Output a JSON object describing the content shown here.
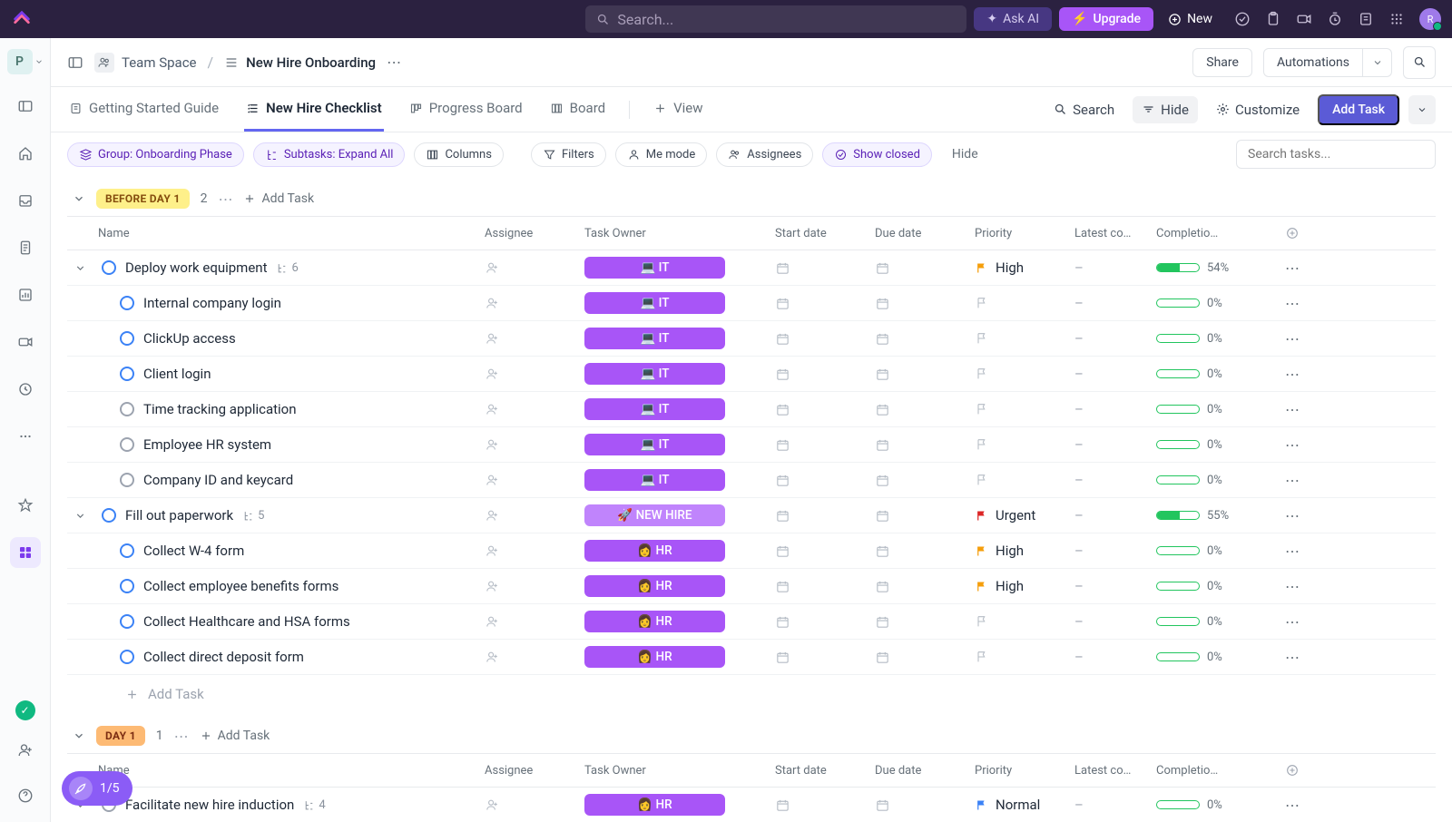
{
  "top": {
    "search_placeholder": "Search...",
    "ask_ai": "Ask AI",
    "upgrade": "Upgrade",
    "new_btn": "New",
    "avatar_letter": "R"
  },
  "workspace_letter": "P",
  "breadcrumb": {
    "team": "Team Space",
    "page": "New Hire Onboarding",
    "share": "Share",
    "automations": "Automations"
  },
  "views": {
    "tabs": [
      "Getting Started Guide",
      "New Hire Checklist",
      "Progress Board",
      "Board"
    ],
    "add_view": "View",
    "search": "Search",
    "hide": "Hide",
    "customize": "Customize",
    "add_task": "Add Task"
  },
  "filters": {
    "group": "Group: Onboarding Phase",
    "subtasks": "Subtasks: Expand All",
    "columns": "Columns",
    "filters": "Filters",
    "me_mode": "Me mode",
    "assignees": "Assignees",
    "show_closed": "Show closed",
    "hide_link": "Hide",
    "search_placeholder": "Search tasks..."
  },
  "columns": {
    "name": "Name",
    "assignee": "Assignee",
    "owner": "Task Owner",
    "start": "Start date",
    "due": "Due date",
    "priority": "Priority",
    "latest": "Latest co…",
    "completion": "Completio…"
  },
  "group_add_task": "Add Task",
  "add_task_row": "Add Task",
  "groups": [
    {
      "label": "BEFORE DAY 1",
      "count": "2",
      "badge_class": "",
      "tasks": [
        {
          "name": "Deploy work equipment",
          "sub": "6",
          "owner": "💻 IT",
          "owner_class": "",
          "pri_flag": "#f59e0b",
          "pri_text": "High",
          "pct": 54,
          "indent": 0,
          "status": "blue",
          "chev": true
        },
        {
          "name": "Internal company login",
          "owner": "💻 IT",
          "owner_class": "",
          "pct": 0,
          "indent": 1,
          "status": "blue"
        },
        {
          "name": "ClickUp access",
          "owner": "💻 IT",
          "owner_class": "",
          "pct": 0,
          "indent": 1,
          "status": "blue"
        },
        {
          "name": "Client login",
          "owner": "💻 IT",
          "owner_class": "",
          "pct": 0,
          "indent": 1,
          "status": "blue"
        },
        {
          "name": "Time tracking application",
          "owner": "💻 IT",
          "owner_class": "",
          "pct": 0,
          "indent": 1,
          "status": "gray"
        },
        {
          "name": "Employee HR system",
          "owner": "💻 IT",
          "owner_class": "",
          "pct": 0,
          "indent": 1,
          "status": "gray"
        },
        {
          "name": "Company ID and keycard",
          "owner": "💻 IT",
          "owner_class": "",
          "pct": 0,
          "indent": 1,
          "status": "gray"
        },
        {
          "name": "Fill out paperwork",
          "sub": "5",
          "owner": "🚀 NEW HIRE",
          "owner_class": "newhire",
          "pri_flag": "#dc2626",
          "pri_text": "Urgent",
          "pct": 55,
          "indent": 0,
          "status": "blue",
          "chev": true
        },
        {
          "name": "Collect W-4 form",
          "owner": "👩 HR",
          "owner_class": "",
          "pri_flag": "#f59e0b",
          "pri_text": "High",
          "pct": 0,
          "indent": 1,
          "status": "blue"
        },
        {
          "name": "Collect employee benefits forms",
          "owner": "👩 HR",
          "owner_class": "",
          "pri_flag": "#f59e0b",
          "pri_text": "High",
          "pct": 0,
          "indent": 1,
          "status": "blue"
        },
        {
          "name": "Collect Healthcare and HSA forms",
          "owner": "👩 HR",
          "owner_class": "",
          "pct": 0,
          "indent": 1,
          "status": "blue"
        },
        {
          "name": "Collect direct deposit form",
          "owner": "👩 HR",
          "owner_class": "",
          "pct": 0,
          "indent": 1,
          "status": "blue"
        }
      ],
      "show_add_row": true
    },
    {
      "label": "DAY 1",
      "count": "1",
      "badge_class": "day1",
      "tasks": [
        {
          "name": "Facilitate new hire induction",
          "sub": "4",
          "owner": "👩 HR",
          "owner_class": "",
          "pri_flag": "#3b82f6",
          "pri_text": "Normal",
          "pct": 0,
          "indent": 0,
          "status": "gray",
          "chev": true
        }
      ],
      "show_add_row": false
    }
  ],
  "float_pill": "1/5"
}
